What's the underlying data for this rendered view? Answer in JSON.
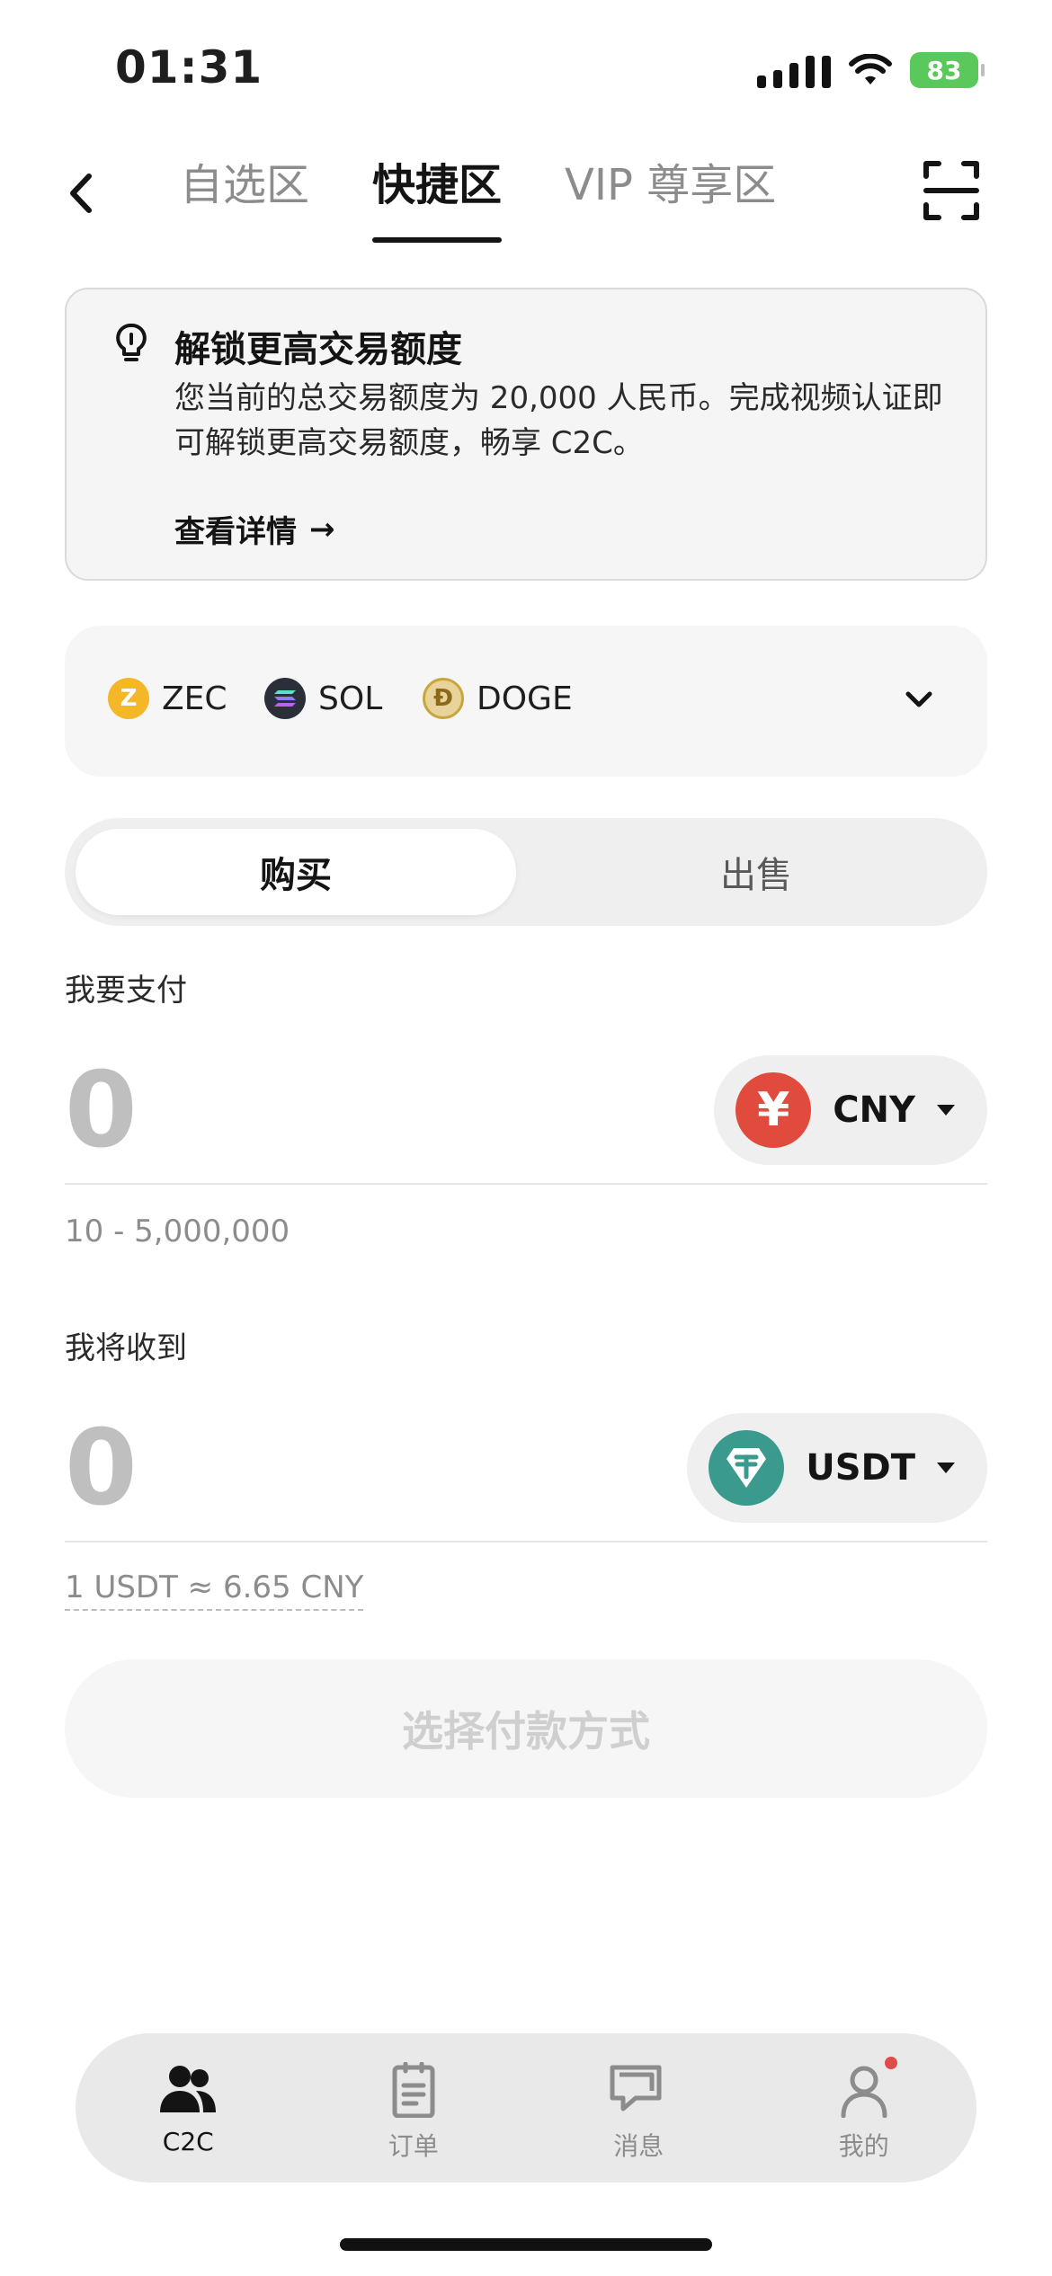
{
  "status_bar": {
    "time": "01:31",
    "battery": "83"
  },
  "nav": {
    "tabs": [
      {
        "label": "自选区",
        "active": false
      },
      {
        "label": "快捷区",
        "active": true
      },
      {
        "label": "VIP 尊享区",
        "active": false
      }
    ]
  },
  "notice": {
    "title": "解锁更高交易额度",
    "body": "您当前的总交易额度为 20,000 人民币。完成视频认证即可解锁更高交易额度，畅享 C2C。",
    "link": "查看详情",
    "link_arrow": "→"
  },
  "coins": [
    {
      "symbol": "ZEC",
      "icon": "zec-icon",
      "glyph": "Z",
      "color": "#f4b728"
    },
    {
      "symbol": "SOL",
      "icon": "sol-icon",
      "glyph": "≡",
      "color": "#2b2f3a"
    },
    {
      "symbol": "DOGE",
      "icon": "doge-icon",
      "glyph": "Ð",
      "color": "#c9a63b"
    }
  ],
  "trade_toggle": {
    "buy": "购买",
    "sell": "出售",
    "selected": "购买"
  },
  "pay": {
    "label": "我要支付",
    "value": "0",
    "currency": "CNY",
    "currency_glyph": "¥",
    "currency_color": "#e04b3e",
    "range": "10 - 5,000,000"
  },
  "receive": {
    "label": "我将收到",
    "value": "0",
    "currency": "USDT",
    "currency_glyph": "₮",
    "currency_color": "#3a9a8e",
    "rate": "1 USDT ≈ 6.65 CNY"
  },
  "cta": {
    "label": "选择付款方式"
  },
  "tabbar": {
    "items": [
      {
        "label": "C2C",
        "icon": "users-icon",
        "active": true
      },
      {
        "label": "订单",
        "icon": "clipboard-icon",
        "active": false
      },
      {
        "label": "消息",
        "icon": "chat-icon",
        "active": false
      },
      {
        "label": "我的",
        "icon": "profile-icon",
        "active": false,
        "badge": true
      }
    ]
  }
}
